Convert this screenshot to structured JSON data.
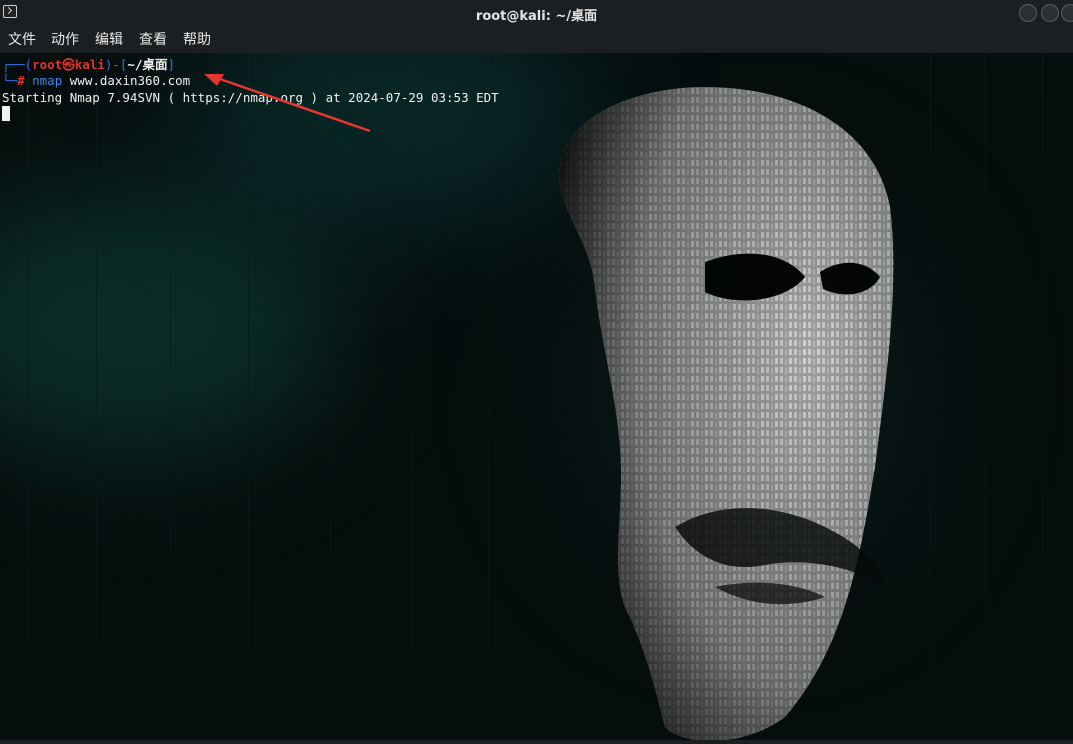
{
  "window": {
    "title": "root@kali: ~/桌面"
  },
  "menu": {
    "items": [
      "文件",
      "动作",
      "编辑",
      "查看",
      "帮助"
    ]
  },
  "terminal": {
    "prompt_open": "┌──(",
    "user": "root",
    "at_symbol": "㉿",
    "host": "kali",
    "mid": ")-[",
    "path": "~/桌面",
    "close": "]",
    "prompt_second": "└─",
    "hash": "#",
    "command": "nmap",
    "argument": "www.daxin360.com",
    "output": "Starting Nmap 7.94SVN ( https://nmap.org ) at 2024-07-29 03:53 EDT"
  },
  "colors": {
    "prompt_frame": "#2f6fe0",
    "user_host": "#e0342c",
    "command": "#3f86e6",
    "arrow": "#e8372d",
    "background": "#060d0d"
  },
  "icons": {
    "app": "terminal-icon",
    "annotation": "red-arrow-icon",
    "wallpaper": "anonymous-mask-wallpaper"
  }
}
